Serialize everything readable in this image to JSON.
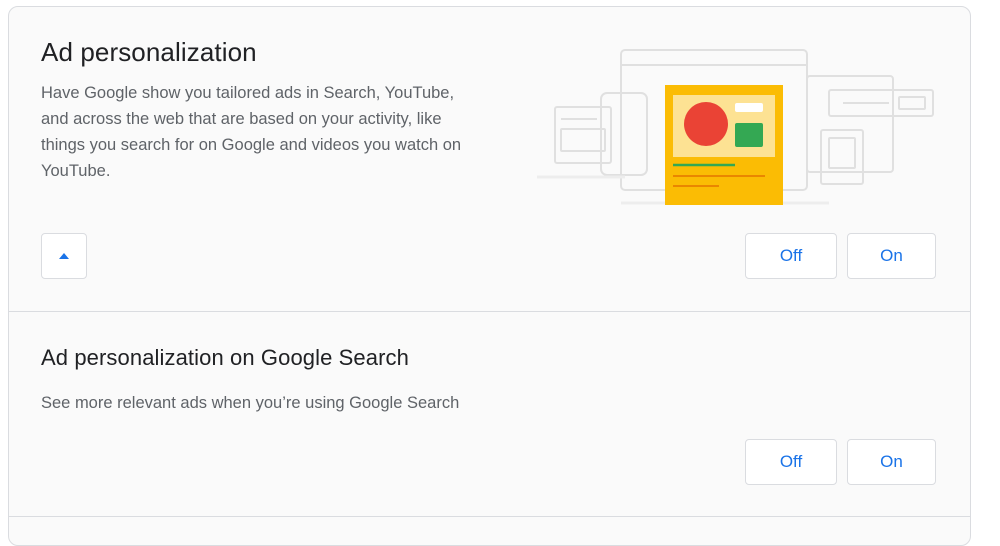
{
  "ad_personalization": {
    "title": "Ad personalization",
    "description": "Have Google show you tailored ads in Search, YouTube, and across the web that are based on your activity, like things you search for on Google and videos you watch on YouTube.",
    "collapse_icon": "caret-up-icon",
    "off_label": "Off",
    "on_label": "On"
  },
  "search_personalization": {
    "title": "Ad personalization on Google Search",
    "description": "See more relevant ads when you’re using Google Search",
    "off_label": "Off",
    "on_label": "On"
  },
  "colors": {
    "accent": "#1a73e8",
    "ad_yellow": "#fbbc04",
    "ad_red": "#ea4335",
    "ad_green": "#34a853",
    "border": "#dadce0"
  }
}
